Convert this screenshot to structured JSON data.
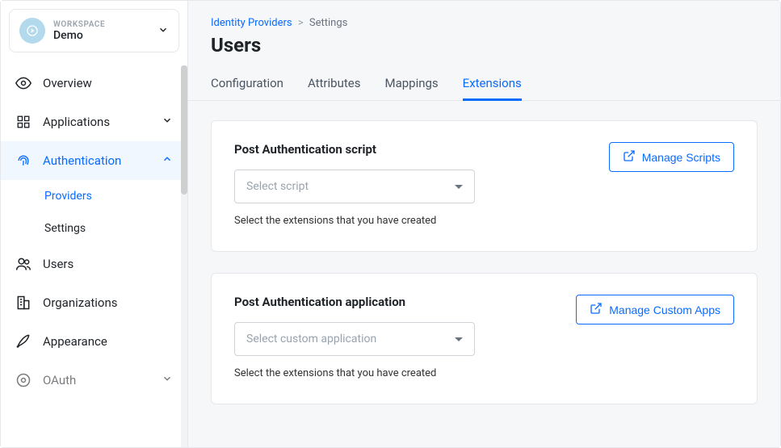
{
  "workspace": {
    "label": "WORKSPACE",
    "name": "Demo"
  },
  "sidebar": {
    "overview": "Overview",
    "applications": "Applications",
    "authentication": "Authentication",
    "authentication_sub": {
      "providers": "Providers",
      "settings": "Settings"
    },
    "users": "Users",
    "organizations": "Organizations",
    "appearance": "Appearance",
    "oauth": "OAuth"
  },
  "breadcrumb": {
    "parent": "Identity Providers",
    "current": "Settings"
  },
  "page_title": "Users",
  "tabs": {
    "configuration": "Configuration",
    "attributes": "Attributes",
    "mappings": "Mappings",
    "extensions": "Extensions"
  },
  "cards": {
    "script": {
      "title": "Post Authentication script",
      "placeholder": "Select script",
      "hint": "Select the extensions that you have created",
      "manage": "Manage Scripts"
    },
    "app": {
      "title": "Post Authentication application",
      "placeholder": "Select custom application",
      "hint": "Select the extensions that you have created",
      "manage": "Manage Custom Apps"
    }
  }
}
